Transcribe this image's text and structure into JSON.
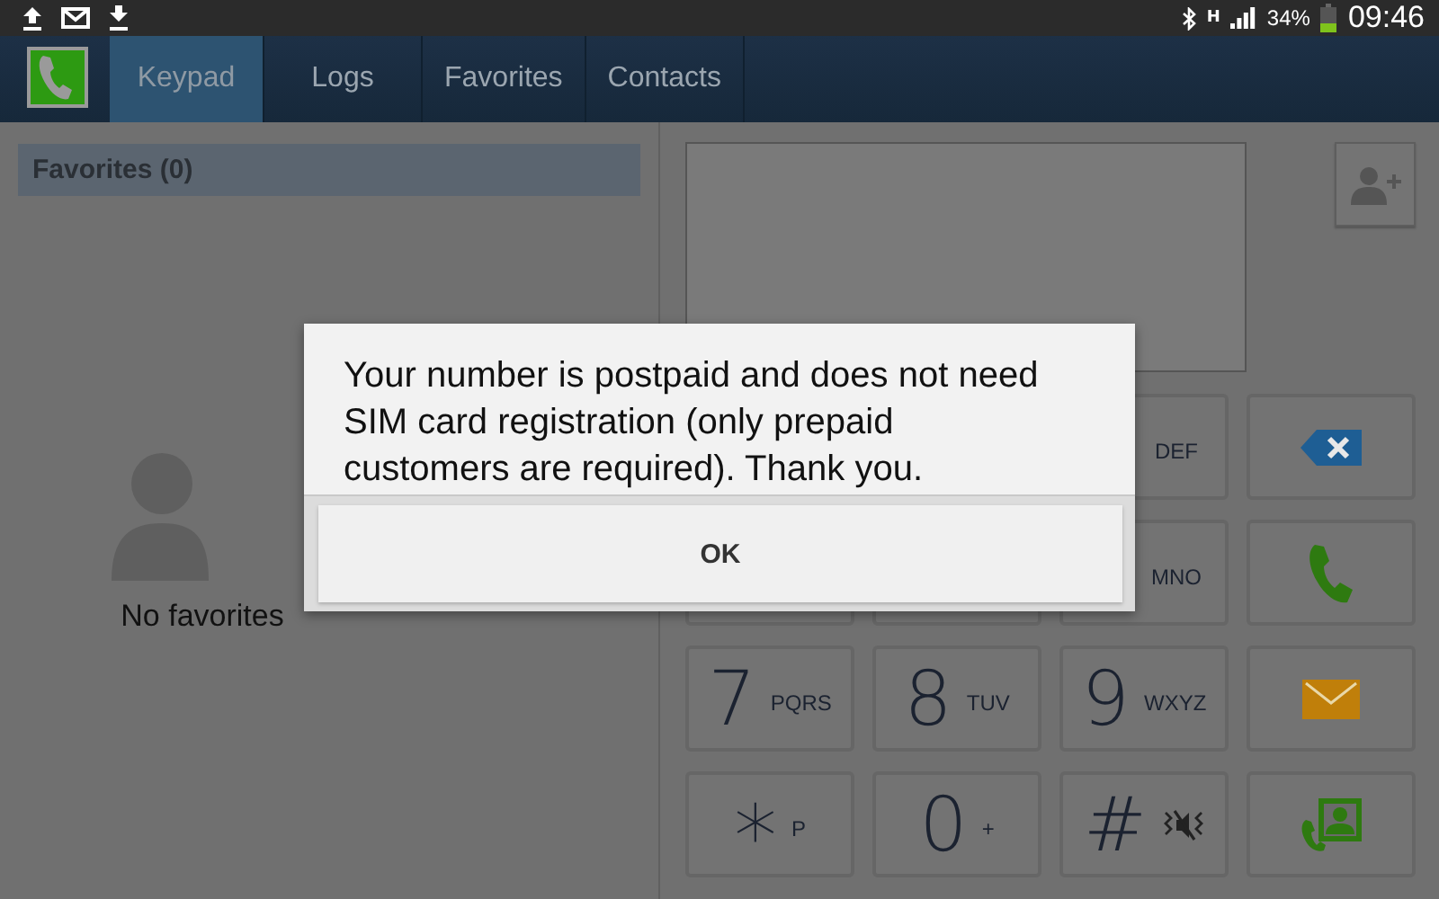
{
  "status_bar": {
    "network": "H",
    "battery": "34%",
    "time": "09:46"
  },
  "tabs": [
    {
      "label": "Keypad",
      "selected": true
    },
    {
      "label": "Logs",
      "selected": false
    },
    {
      "label": "Favorites",
      "selected": false
    },
    {
      "label": "Contacts",
      "selected": false
    }
  ],
  "favorites": {
    "header": "Favorites (0)",
    "empty_text": "No favorites"
  },
  "keypad": {
    "keys": [
      {
        "kind": "digit",
        "letters": "DEF"
      },
      {
        "kind": "delete"
      },
      {
        "kind": "covered"
      },
      {
        "kind": "covered"
      },
      {
        "kind": "digit",
        "letters": "MNO"
      },
      {
        "kind": "call"
      },
      {
        "kind": "digit",
        "digit": "7",
        "letters": "PQRS"
      },
      {
        "kind": "digit",
        "digit": "8",
        "letters": "TUV"
      },
      {
        "kind": "digit",
        "digit": "9",
        "letters": "WXYZ"
      },
      {
        "kind": "message"
      },
      {
        "kind": "digit",
        "digit": "*",
        "letters": "P"
      },
      {
        "kind": "digit",
        "digit": "0",
        "letters": "+"
      },
      {
        "kind": "mute",
        "digit": "#"
      },
      {
        "kind": "contacts"
      }
    ]
  },
  "dialog": {
    "message": "Your number is postpaid and does not need SIM card registration (only prepaid customers are required). Thank you.",
    "button": "OK"
  }
}
